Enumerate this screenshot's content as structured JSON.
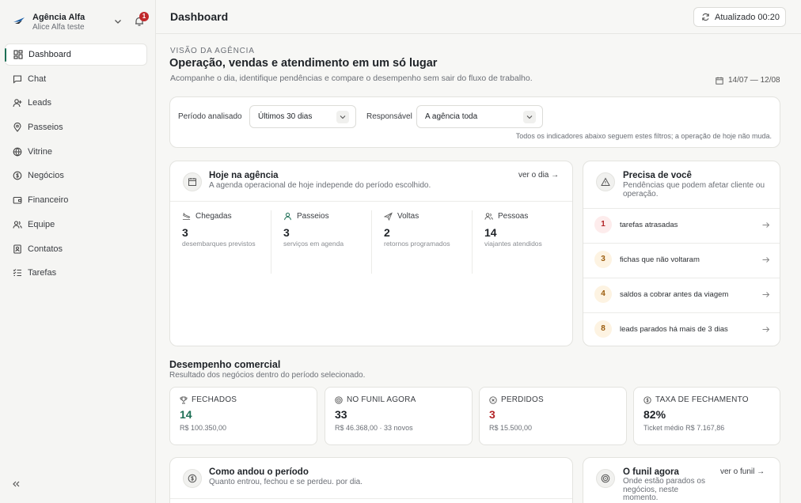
{
  "sidebar": {
    "brand_name": "Agência Alfa",
    "brand_user": "Alice Alfa teste",
    "notification_count": "1",
    "items": [
      {
        "label": "Dashboard",
        "icon": "dashboard-icon",
        "active": true
      },
      {
        "label": "Chat",
        "icon": "chat-icon"
      },
      {
        "label": "Leads",
        "icon": "user-plus-icon"
      },
      {
        "label": "Passeios",
        "icon": "map-pin-icon"
      },
      {
        "label": "Vitrine",
        "icon": "globe-icon"
      },
      {
        "label": "Negócios",
        "icon": "dollar-icon"
      },
      {
        "label": "Financeiro",
        "icon": "wallet-icon"
      },
      {
        "label": "Equipe",
        "icon": "users-icon"
      },
      {
        "label": "Contatos",
        "icon": "contacts-icon"
      },
      {
        "label": "Tarefas",
        "icon": "tasks-icon"
      }
    ]
  },
  "topbar": {
    "title": "Dashboard",
    "refresh_label": "Atualizado 00:20"
  },
  "intro": {
    "eyebrow": "VISÃO DA AGÊNCIA",
    "headline": "Operação, vendas e atendimento em um só lugar",
    "subline": "Acompanhe o dia, identifique pendências e compare o desempenho sem sair do fluxo de trabalho.",
    "date_range": "14/07 — 12/08"
  },
  "filters": {
    "period_label": "Período analisado",
    "period_value": "Últimos 30 dias",
    "owner_label": "Responsável",
    "owner_value": "A agência toda",
    "note": "Todos os indicadores abaixo seguem estes filtros; a operação de hoje não muda."
  },
  "hoje": {
    "title": "Hoje na agência",
    "subtitle": "A agenda operacional de hoje independe do período escolhido.",
    "link": "ver o dia →",
    "stats": [
      {
        "label": "Chegadas",
        "value": "3",
        "desc": "desembarques previstos"
      },
      {
        "label": "Passeios",
        "value": "3",
        "desc": "serviços em agenda"
      },
      {
        "label": "Voltas",
        "value": "2",
        "desc": "retornos programados"
      },
      {
        "label": "Pessoas",
        "value": "14",
        "desc": "viajantes atendidos"
      }
    ]
  },
  "precisa": {
    "title": "Precisa de você",
    "subtitle": "Pendências que podem afetar cliente ou operação.",
    "tasks": [
      {
        "count": "1",
        "text": "tarefas atrasadas"
      },
      {
        "count": "3",
        "text": "fichas que não voltaram"
      },
      {
        "count": "4",
        "text": "saldos a cobrar antes da viagem"
      },
      {
        "count": "8",
        "text": "leads parados há mais de 3 dias"
      }
    ]
  },
  "desempenho": {
    "title": "Desempenho comercial",
    "subtitle": "Resultado dos negócios dentro do período selecionado.",
    "kpis": [
      {
        "label": "FECHADOS",
        "value": "14",
        "sub": "R$ 100.350,00"
      },
      {
        "label": "NO FUNIL AGORA",
        "value": "33",
        "sub": "R$ 46.368,00 · 33 novos"
      },
      {
        "label": "PERDIDOS",
        "value": "3",
        "sub": "R$ 15.500,00"
      },
      {
        "label": "TAXA DE FECHAMENTO",
        "value": "82%",
        "sub": "Ticket médio R$ 7.167,86"
      }
    ]
  },
  "periodo": {
    "title": "Como andou o período",
    "subtitle": "Quanto entrou, fechou e se perdeu. por dia."
  },
  "funil": {
    "title": "O funil agora",
    "subtitle": "Onde estão parados os negócios, neste momento.",
    "link": "ver o funil →"
  },
  "colors": {
    "accent": "#1d6f55",
    "danger": "#b32528",
    "warning": "#9a5b0c"
  }
}
